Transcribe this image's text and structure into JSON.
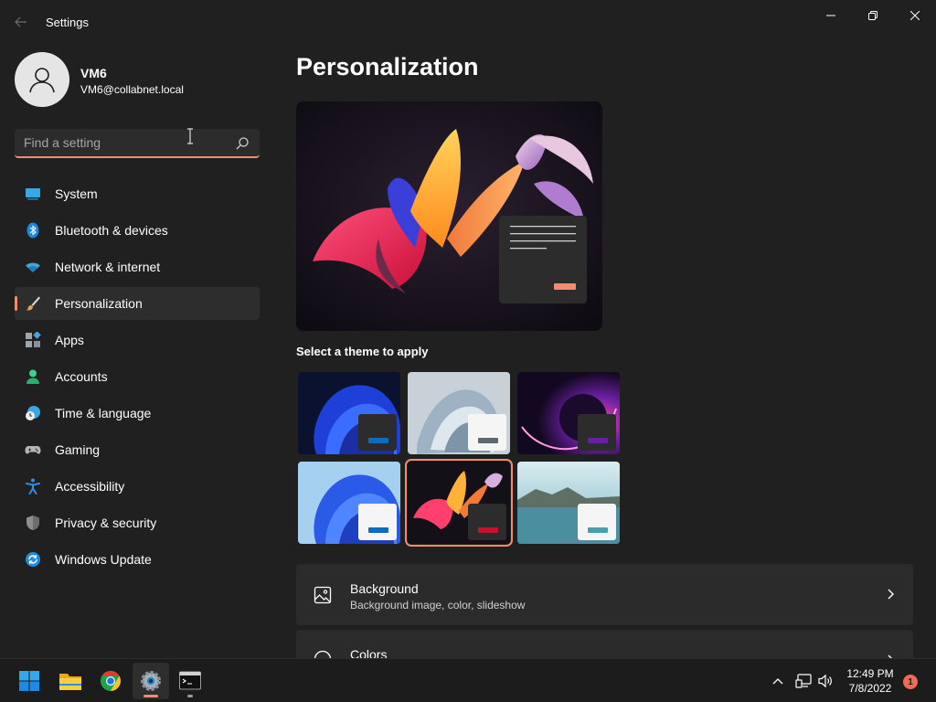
{
  "window": {
    "title": "Settings"
  },
  "user": {
    "name": "VM6",
    "email": "VM6@collabnet.local"
  },
  "search": {
    "placeholder": "Find a setting",
    "value": ""
  },
  "sidebar": {
    "items": [
      {
        "label": "System",
        "icon": "system-icon",
        "active": false
      },
      {
        "label": "Bluetooth & devices",
        "icon": "bluetooth-icon",
        "active": false
      },
      {
        "label": "Network & internet",
        "icon": "wifi-icon",
        "active": false
      },
      {
        "label": "Personalization",
        "icon": "paintbrush-icon",
        "active": true
      },
      {
        "label": "Apps",
        "icon": "apps-icon",
        "active": false
      },
      {
        "label": "Accounts",
        "icon": "person-icon",
        "active": false
      },
      {
        "label": "Time & language",
        "icon": "globe-clock-icon",
        "active": false
      },
      {
        "label": "Gaming",
        "icon": "gamepad-icon",
        "active": false
      },
      {
        "label": "Accessibility",
        "icon": "accessibility-icon",
        "active": false
      },
      {
        "label": "Privacy & security",
        "icon": "shield-icon",
        "active": false
      },
      {
        "label": "Windows Update",
        "icon": "update-icon",
        "active": false
      }
    ]
  },
  "main": {
    "title": "Personalization",
    "themes_heading": "Select a theme to apply",
    "themes": [
      {
        "name": "windows-dark-bloom",
        "accent": "#0f6cbd",
        "selected": false
      },
      {
        "name": "windows-light-captured-motion",
        "accent": "#5e6870",
        "selected": false
      },
      {
        "name": "glow",
        "accent": "#6b1fa0",
        "selected": false
      },
      {
        "name": "windows-light-bloom",
        "accent": "#0f6cbd",
        "selected": false
      },
      {
        "name": "dark-flow",
        "accent": "#c8102e",
        "selected": true
      },
      {
        "name": "sunrise-lake",
        "accent": "#4a9fae",
        "selected": false
      }
    ],
    "cards": [
      {
        "title": "Background",
        "subtitle": "Background image, color, slideshow",
        "icon": "image-icon"
      },
      {
        "title": "Colors",
        "subtitle": "",
        "icon": "palette-icon"
      }
    ]
  },
  "taskbar": {
    "time": "12:49 PM",
    "date": "7/8/2022",
    "notification_count": "1",
    "apps": [
      "start-icon",
      "file-explorer-icon",
      "chrome-icon",
      "settings-icon",
      "terminal-icon"
    ]
  },
  "colors": {
    "accent": "#f08c70",
    "background": "#202020",
    "card": "#2b2b2b"
  }
}
